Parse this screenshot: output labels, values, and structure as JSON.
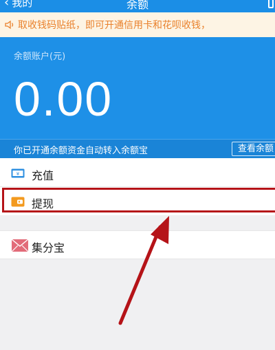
{
  "header": {
    "back_label": "我的",
    "title": "余额"
  },
  "notice": {
    "text": "取收钱码贴纸，即可开通信用卡和花呗收钱，"
  },
  "balance": {
    "label": "余额账户(元)",
    "amount": "0.00",
    "info_text": "你已开通余额资金自动转入余额宝",
    "view_button": "查看余额"
  },
  "list": {
    "recharge": "充值",
    "withdraw": "提现",
    "jifen": "集分宝"
  },
  "colors": {
    "brand_blue": "#1e90e7",
    "notice_orange": "#e9812c",
    "annotation_red": "#b51318"
  }
}
